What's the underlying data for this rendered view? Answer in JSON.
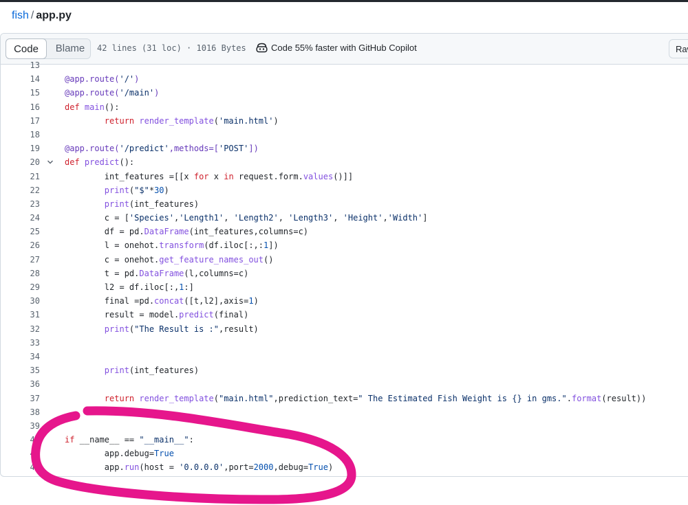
{
  "breadcrumb": {
    "repo": "fish",
    "separator": "/",
    "file": "app.py"
  },
  "toolbar": {
    "code_label": "Code",
    "blame_label": "Blame",
    "file_info": "42 lines (31 loc) · 1016 Bytes",
    "copilot_label": "Code 55% faster with GitHub Copilot",
    "raw_label": "Raw"
  },
  "code_lines": [
    {
      "n": "13",
      "tokens": []
    },
    {
      "n": "14",
      "tokens": [
        [
          "dec",
          "@app.route("
        ],
        [
          "str",
          "'/'"
        ],
        [
          "dec",
          ")"
        ]
      ]
    },
    {
      "n": "15",
      "tokens": [
        [
          "dec",
          "@app.route("
        ],
        [
          "str",
          "'/main'"
        ],
        [
          "dec",
          ")"
        ]
      ]
    },
    {
      "n": "16",
      "tokens": [
        [
          "kw",
          "def "
        ],
        [
          "fn",
          "main"
        ],
        [
          "",
          "():"
        ]
      ]
    },
    {
      "n": "17",
      "tokens": [
        [
          "",
          "        "
        ],
        [
          "kw",
          "return "
        ],
        [
          "fn",
          "render_template"
        ],
        [
          "",
          "("
        ],
        [
          "str",
          "'main.html'"
        ],
        [
          "",
          ")"
        ]
      ]
    },
    {
      "n": "18",
      "tokens": []
    },
    {
      "n": "19",
      "tokens": [
        [
          "dec",
          "@app.route("
        ],
        [
          "str",
          "'/predict'"
        ],
        [
          "dec",
          ",methods=["
        ],
        [
          "str",
          "'POST'"
        ],
        [
          "dec",
          "])"
        ]
      ]
    },
    {
      "n": "20",
      "fold": true,
      "tokens": [
        [
          "kw",
          "def "
        ],
        [
          "fn",
          "predict"
        ],
        [
          "",
          "():"
        ]
      ]
    },
    {
      "n": "21",
      "tokens": [
        [
          "",
          "        int_features =[[x "
        ],
        [
          "kw",
          "for"
        ],
        [
          "",
          " x "
        ],
        [
          "kw",
          "in"
        ],
        [
          "",
          " request.form."
        ],
        [
          "fn",
          "values"
        ],
        [
          "",
          "()]]"
        ]
      ]
    },
    {
      "n": "22",
      "tokens": [
        [
          "",
          "        "
        ],
        [
          "fn",
          "print"
        ],
        [
          "",
          "("
        ],
        [
          "str",
          "\"$\""
        ],
        [
          "",
          "*"
        ],
        [
          "num",
          "30"
        ],
        [
          "",
          ")"
        ]
      ]
    },
    {
      "n": "23",
      "tokens": [
        [
          "",
          "        "
        ],
        [
          "fn",
          "print"
        ],
        [
          "",
          "(int_features)"
        ]
      ]
    },
    {
      "n": "24",
      "tokens": [
        [
          "",
          "        c = ["
        ],
        [
          "str",
          "'Species'"
        ],
        [
          "",
          ","
        ],
        [
          "str",
          "'Length1'"
        ],
        [
          "",
          ", "
        ],
        [
          "str",
          "'Length2'"
        ],
        [
          "",
          ", "
        ],
        [
          "str",
          "'Length3'"
        ],
        [
          "",
          ", "
        ],
        [
          "str",
          "'Height'"
        ],
        [
          "",
          ","
        ],
        [
          "str",
          "'Width'"
        ],
        [
          "",
          "]"
        ]
      ]
    },
    {
      "n": "25",
      "tokens": [
        [
          "",
          "        df = pd."
        ],
        [
          "fn",
          "DataFrame"
        ],
        [
          "",
          "(int_features,columns=c)"
        ]
      ]
    },
    {
      "n": "26",
      "tokens": [
        [
          "",
          "        l = onehot."
        ],
        [
          "fn",
          "transform"
        ],
        [
          "",
          "(df.iloc[:,:"
        ],
        [
          "num",
          "1"
        ],
        [
          "",
          "])"
        ]
      ]
    },
    {
      "n": "27",
      "tokens": [
        [
          "",
          "        c = onehot."
        ],
        [
          "fn",
          "get_feature_names_out"
        ],
        [
          "",
          "()"
        ]
      ]
    },
    {
      "n": "28",
      "tokens": [
        [
          "",
          "        t = pd."
        ],
        [
          "fn",
          "DataFrame"
        ],
        [
          "",
          "(l,columns=c)"
        ]
      ]
    },
    {
      "n": "29",
      "tokens": [
        [
          "",
          "        l2 = df.iloc[:,"
        ],
        [
          "num",
          "1"
        ],
        [
          "",
          ":]"
        ]
      ]
    },
    {
      "n": "30",
      "tokens": [
        [
          "",
          "        final =pd."
        ],
        [
          "fn",
          "concat"
        ],
        [
          "",
          "([t,l2],axis="
        ],
        [
          "num",
          "1"
        ],
        [
          "",
          ")"
        ]
      ]
    },
    {
      "n": "31",
      "tokens": [
        [
          "",
          "        result = model."
        ],
        [
          "fn",
          "predict"
        ],
        [
          "",
          "(final)"
        ]
      ]
    },
    {
      "n": "32",
      "tokens": [
        [
          "",
          "        "
        ],
        [
          "fn",
          "print"
        ],
        [
          "",
          "("
        ],
        [
          "str",
          "\"The Result is :\""
        ],
        [
          "",
          ",result)"
        ]
      ]
    },
    {
      "n": "33",
      "tokens": []
    },
    {
      "n": "34",
      "tokens": []
    },
    {
      "n": "35",
      "tokens": [
        [
          "",
          "        "
        ],
        [
          "fn",
          "print"
        ],
        [
          "",
          "(int_features)"
        ]
      ]
    },
    {
      "n": "36",
      "tokens": []
    },
    {
      "n": "37",
      "tokens": [
        [
          "",
          "        "
        ],
        [
          "kw",
          "return "
        ],
        [
          "fn",
          "render_template"
        ],
        [
          "",
          "("
        ],
        [
          "str",
          "\"main.html\""
        ],
        [
          "",
          ",prediction_text="
        ],
        [
          "str",
          "\" The Estimated Fish Weight is {} in gms.\""
        ],
        [
          "",
          "."
        ],
        [
          "fn",
          "format"
        ],
        [
          "",
          "(result))"
        ]
      ]
    },
    {
      "n": "38",
      "tokens": []
    },
    {
      "n": "39",
      "tokens": []
    },
    {
      "n": "40",
      "tokens": [
        [
          "kw",
          "if"
        ],
        [
          "",
          " __name__ == "
        ],
        [
          "str",
          "\"__main__\""
        ],
        [
          "",
          ":"
        ]
      ]
    },
    {
      "n": "41",
      "tokens": [
        [
          "",
          "        app.debug="
        ],
        [
          "num",
          "True"
        ]
      ]
    },
    {
      "n": "42",
      "tokens": [
        [
          "",
          "        app."
        ],
        [
          "fn",
          "run"
        ],
        [
          "",
          "(host = "
        ],
        [
          "str",
          "'0.0.0.0'"
        ],
        [
          "",
          ",port="
        ],
        [
          "num",
          "2000"
        ],
        [
          "",
          ",debug="
        ],
        [
          "num",
          "True"
        ],
        [
          "",
          ")"
        ]
      ]
    }
  ],
  "colors": {
    "link": "#0969da",
    "keyword": "#cf222e",
    "string": "#0a3069",
    "constant": "#0550ae",
    "function": "#8250df",
    "annotation": "#e6168c"
  },
  "icons": {
    "copilot": "copilot-icon",
    "fold": "chevron-down-icon"
  }
}
